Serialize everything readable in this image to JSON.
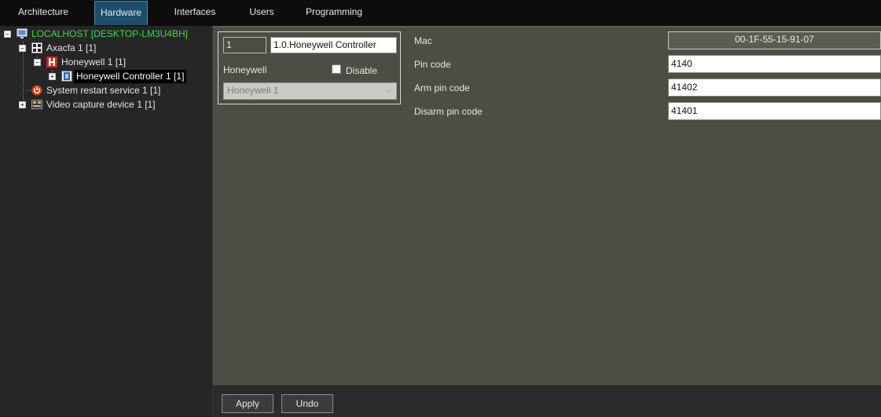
{
  "tabs": [
    {
      "label": "Architecture"
    },
    {
      "label": "Hardware"
    },
    {
      "label": "Interfaces"
    },
    {
      "label": "Users"
    },
    {
      "label": "Programming"
    }
  ],
  "tree": {
    "root": "LOCALHOST [DESKTOP-LM3U4BH]",
    "axxon": "Axacfa 1 [1]",
    "honeywell": "Honeywell 1 [1]",
    "controller": "Honeywell Controller 1 [1]",
    "restart": "System restart service 1 [1]",
    "video": "Video capture device 1 [1]",
    "icons": {
      "root": "monitor-icon",
      "axxon": "grid-icon",
      "honeywell": "honeywell-h-icon",
      "controller": "controller-icon",
      "restart": "power-icon",
      "video": "capture-card-icon"
    }
  },
  "form": {
    "id_value": "1",
    "name_value": "1.0.Honeywell Controller",
    "parent_label": "Honeywell",
    "disable_label": "Disable",
    "parent_select": "Honeywell 1",
    "mac_label": "Mac",
    "mac_value": "00-1F-55-15-91-07",
    "pin_label": "Pin code",
    "pin_value": "4140",
    "arm_label": "Arm pin code",
    "arm_value": "41402",
    "disarm_label": "Disarm pin code",
    "disarm_value": "41401"
  },
  "buttons": {
    "apply": "Apply",
    "undo": "Undo"
  },
  "colors": {
    "root_text": "#3ddc3d",
    "active_tab": "#1d4f6d",
    "panel_bg": "#4b4e42"
  }
}
